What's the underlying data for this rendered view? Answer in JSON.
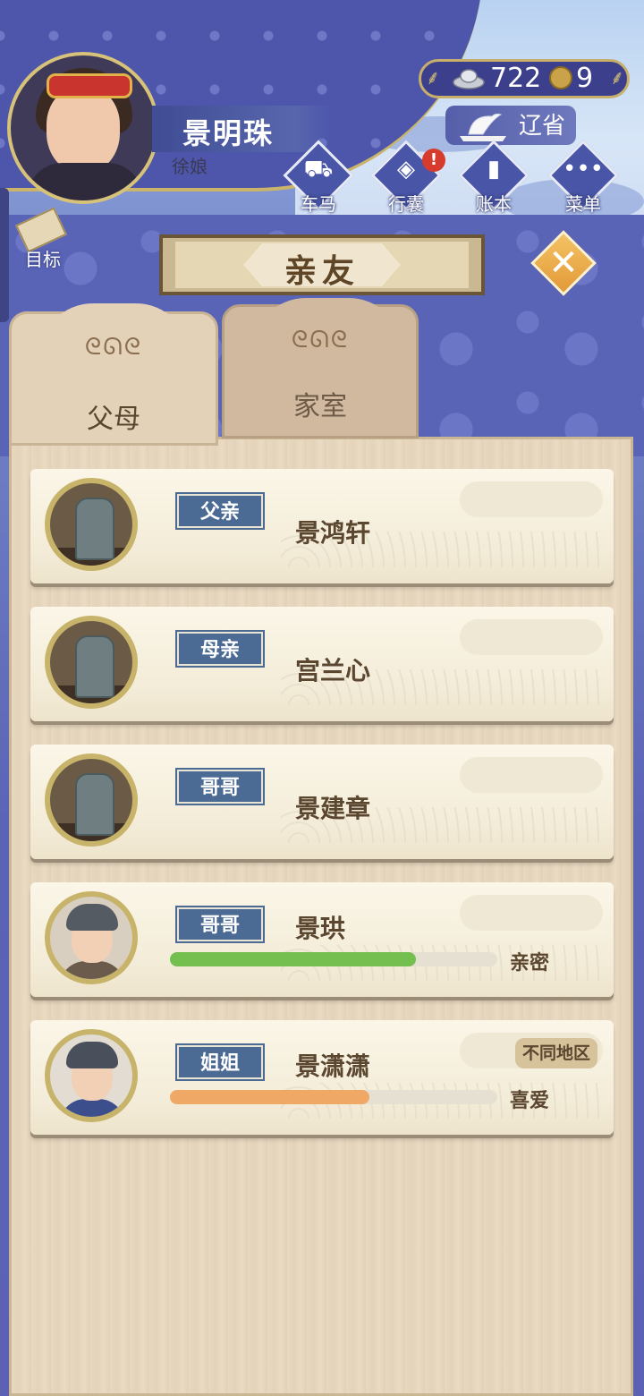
{
  "player": {
    "name": "景明珠",
    "title": "徐娘"
  },
  "currency": {
    "silver": "722",
    "coins": "9"
  },
  "region": {
    "label": "辽省"
  },
  "menu": [
    {
      "label": "车马",
      "icon": "carriage-icon",
      "glyph": "⛟"
    },
    {
      "label": "行囊",
      "icon": "bag-icon",
      "glyph": "◈",
      "badge": "!"
    },
    {
      "label": "账本",
      "icon": "ledger-icon",
      "glyph": "▮"
    },
    {
      "label": "菜单",
      "icon": "more-icon",
      "glyph": "•••"
    }
  ],
  "goal": {
    "label": "目标"
  },
  "title": "亲友",
  "tabs": [
    {
      "label": "父母",
      "active": true,
      "swirl": "ᘓᘏᘓ"
    },
    {
      "label": "家室",
      "active": false,
      "swirl": "ᘓᘏᘓ"
    }
  ],
  "relatives": [
    {
      "relation": "父亲",
      "name": "景鸿轩",
      "deceased": true
    },
    {
      "relation": "母亲",
      "name": "宫兰心",
      "deceased": true
    },
    {
      "relation": "哥哥",
      "name": "景建章",
      "deceased": true
    },
    {
      "relation": "哥哥",
      "name": "景珙",
      "deceased": false,
      "affinity_label": "亲密",
      "affinity": 0.75,
      "bar_color": "#74bf4f"
    },
    {
      "relation": "姐姐",
      "name": "景潇潇",
      "deceased": false,
      "affinity_label": "喜爱",
      "affinity": 0.61,
      "bar_color": "#f0a866",
      "region_tag": "不同地区"
    }
  ],
  "colors": {
    "badge_blue": "#4c6b94",
    "accent_gold": "#c9b46a",
    "text_brown": "#5b4630"
  }
}
